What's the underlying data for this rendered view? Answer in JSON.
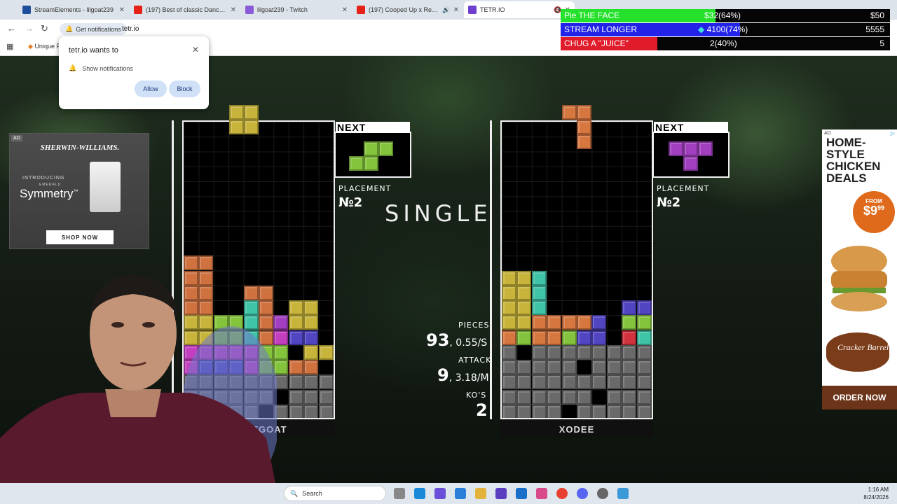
{
  "browser": {
    "tabs": [
      {
        "label": "StreamElements - lilgoat239",
        "color": "#1f4f9c",
        "active": false,
        "muted": false
      },
      {
        "label": "(197) Best of classic Dance & H",
        "color": "#e62117",
        "active": false,
        "muted": false
      },
      {
        "label": "lilgoat239 - Twitch",
        "color": "#8a5ad8",
        "active": false,
        "muted": false
      },
      {
        "label": "(197) Cooped Up x Return o",
        "color": "#e62117",
        "active": false,
        "muted": true
      },
      {
        "label": "TETR.IO",
        "color": "#6f3fd0",
        "active": true,
        "muted": true
      }
    ],
    "get_notifications": "Get notifications",
    "url": "tetr.io",
    "bookmark": "Unique F",
    "ask_gemini": "Ask Gemini"
  },
  "popup": {
    "title": "tetr.io wants to",
    "row": "Show notifications",
    "allow": "Allow",
    "block": "Block"
  },
  "ad_left": {
    "tag": "AD",
    "brand": "SHERWIN-WILLIAMS.",
    "intro": "INTRODUCING",
    "emerald": "EMERALD",
    "product": "Symmetry",
    "tm": "™",
    "cta": "SHOP NOW"
  },
  "ad_right": {
    "tag": "AD",
    "headline": "HOME-STYLE CHICKEN DEALS",
    "from": "FROM",
    "price": "$9",
    "cents": "99",
    "logo": "Cracker Barrel",
    "cta": "ORDER NOW"
  },
  "overlay": [
    {
      "label": "Pie THE FACE",
      "value": "$32(64%)",
      "fraction": 0.64,
      "color": "#26e12c",
      "right": "$50"
    },
    {
      "label": "STREAM LONGER",
      "value": "4100(74%)",
      "fraction": 0.74,
      "color": "#2222e8",
      "right": "5555",
      "gem": true
    },
    {
      "label": "CHUG A \"JUICE\"",
      "value": "2(40%)",
      "fraction": 0.4,
      "color": "#e01b2a",
      "right": "5"
    }
  ],
  "game": {
    "next_label": "NEXT",
    "placement_label": "PLACEMENT",
    "p1_placement": "№2",
    "p2_placement": "№2",
    "center_text": "SINGLE",
    "stats": {
      "pieces_label": "PIECES",
      "pieces": "93",
      "pps": ", 0.55/S",
      "attack_label": "ATTACK",
      "attack": "9",
      "apm": ", 3.18/M",
      "kos_label": "KO'S",
      "kos": "2"
    },
    "player1": "GOATGOAT",
    "player2": "XODEE",
    "board1": [
      "..........",
      "..........",
      "..........",
      "..........",
      "..........",
      "..........",
      "..........",
      "..........",
      "..........",
      "ZZ........",
      "ZZ........",
      "ZZ..ZZ....",
      "ZZ..IZ.OO.",
      "OOSSIZTOO.",
      "OOSSIZPJJ.",
      "PPPPPSS.OO",
      "PJJJPSSZZ.",
      "GGGGGGGGGG",
      "GGGGGG.GGG",
      "GGGGG.GGGG"
    ],
    "board2": [
      "..........",
      "..........",
      "..........",
      "..........",
      "..........",
      "..........",
      "..........",
      "..........",
      "..........",
      "..........",
      "OOI.......",
      "OOI.......",
      "OOI.....JJJ",
      "OOLLLLJ.SSP",
      "LSLLSJJ.ZrI",
      "G.GGGGGGGG",
      "GGGGG.GGGG",
      "GGGGGGGGGG",
      "GGGGGG.GGG",
      "GGGG.GGGGG"
    ]
  },
  "taskbar": {
    "search": "Search",
    "time": "1:16 AM",
    "date": "8/24/2026"
  }
}
